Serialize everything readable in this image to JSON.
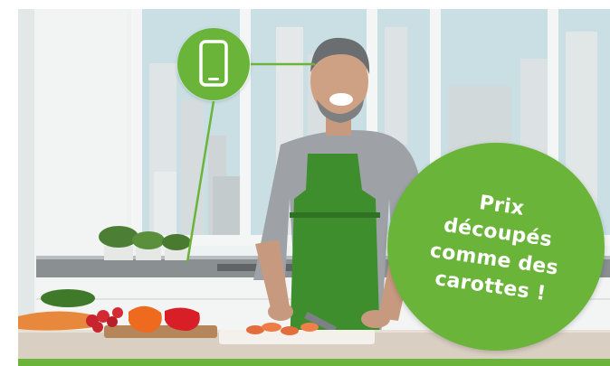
{
  "promo": {
    "lines": [
      "Prix",
      "découpés",
      "comme des",
      "carottes !"
    ]
  },
  "icons": {
    "phone": "smartphone-icon"
  },
  "colors": {
    "brand_green": "#6bb43a",
    "apron_green": "#3e8e2e",
    "sky": "#c9dfe4",
    "wall": "#eef2f2"
  }
}
